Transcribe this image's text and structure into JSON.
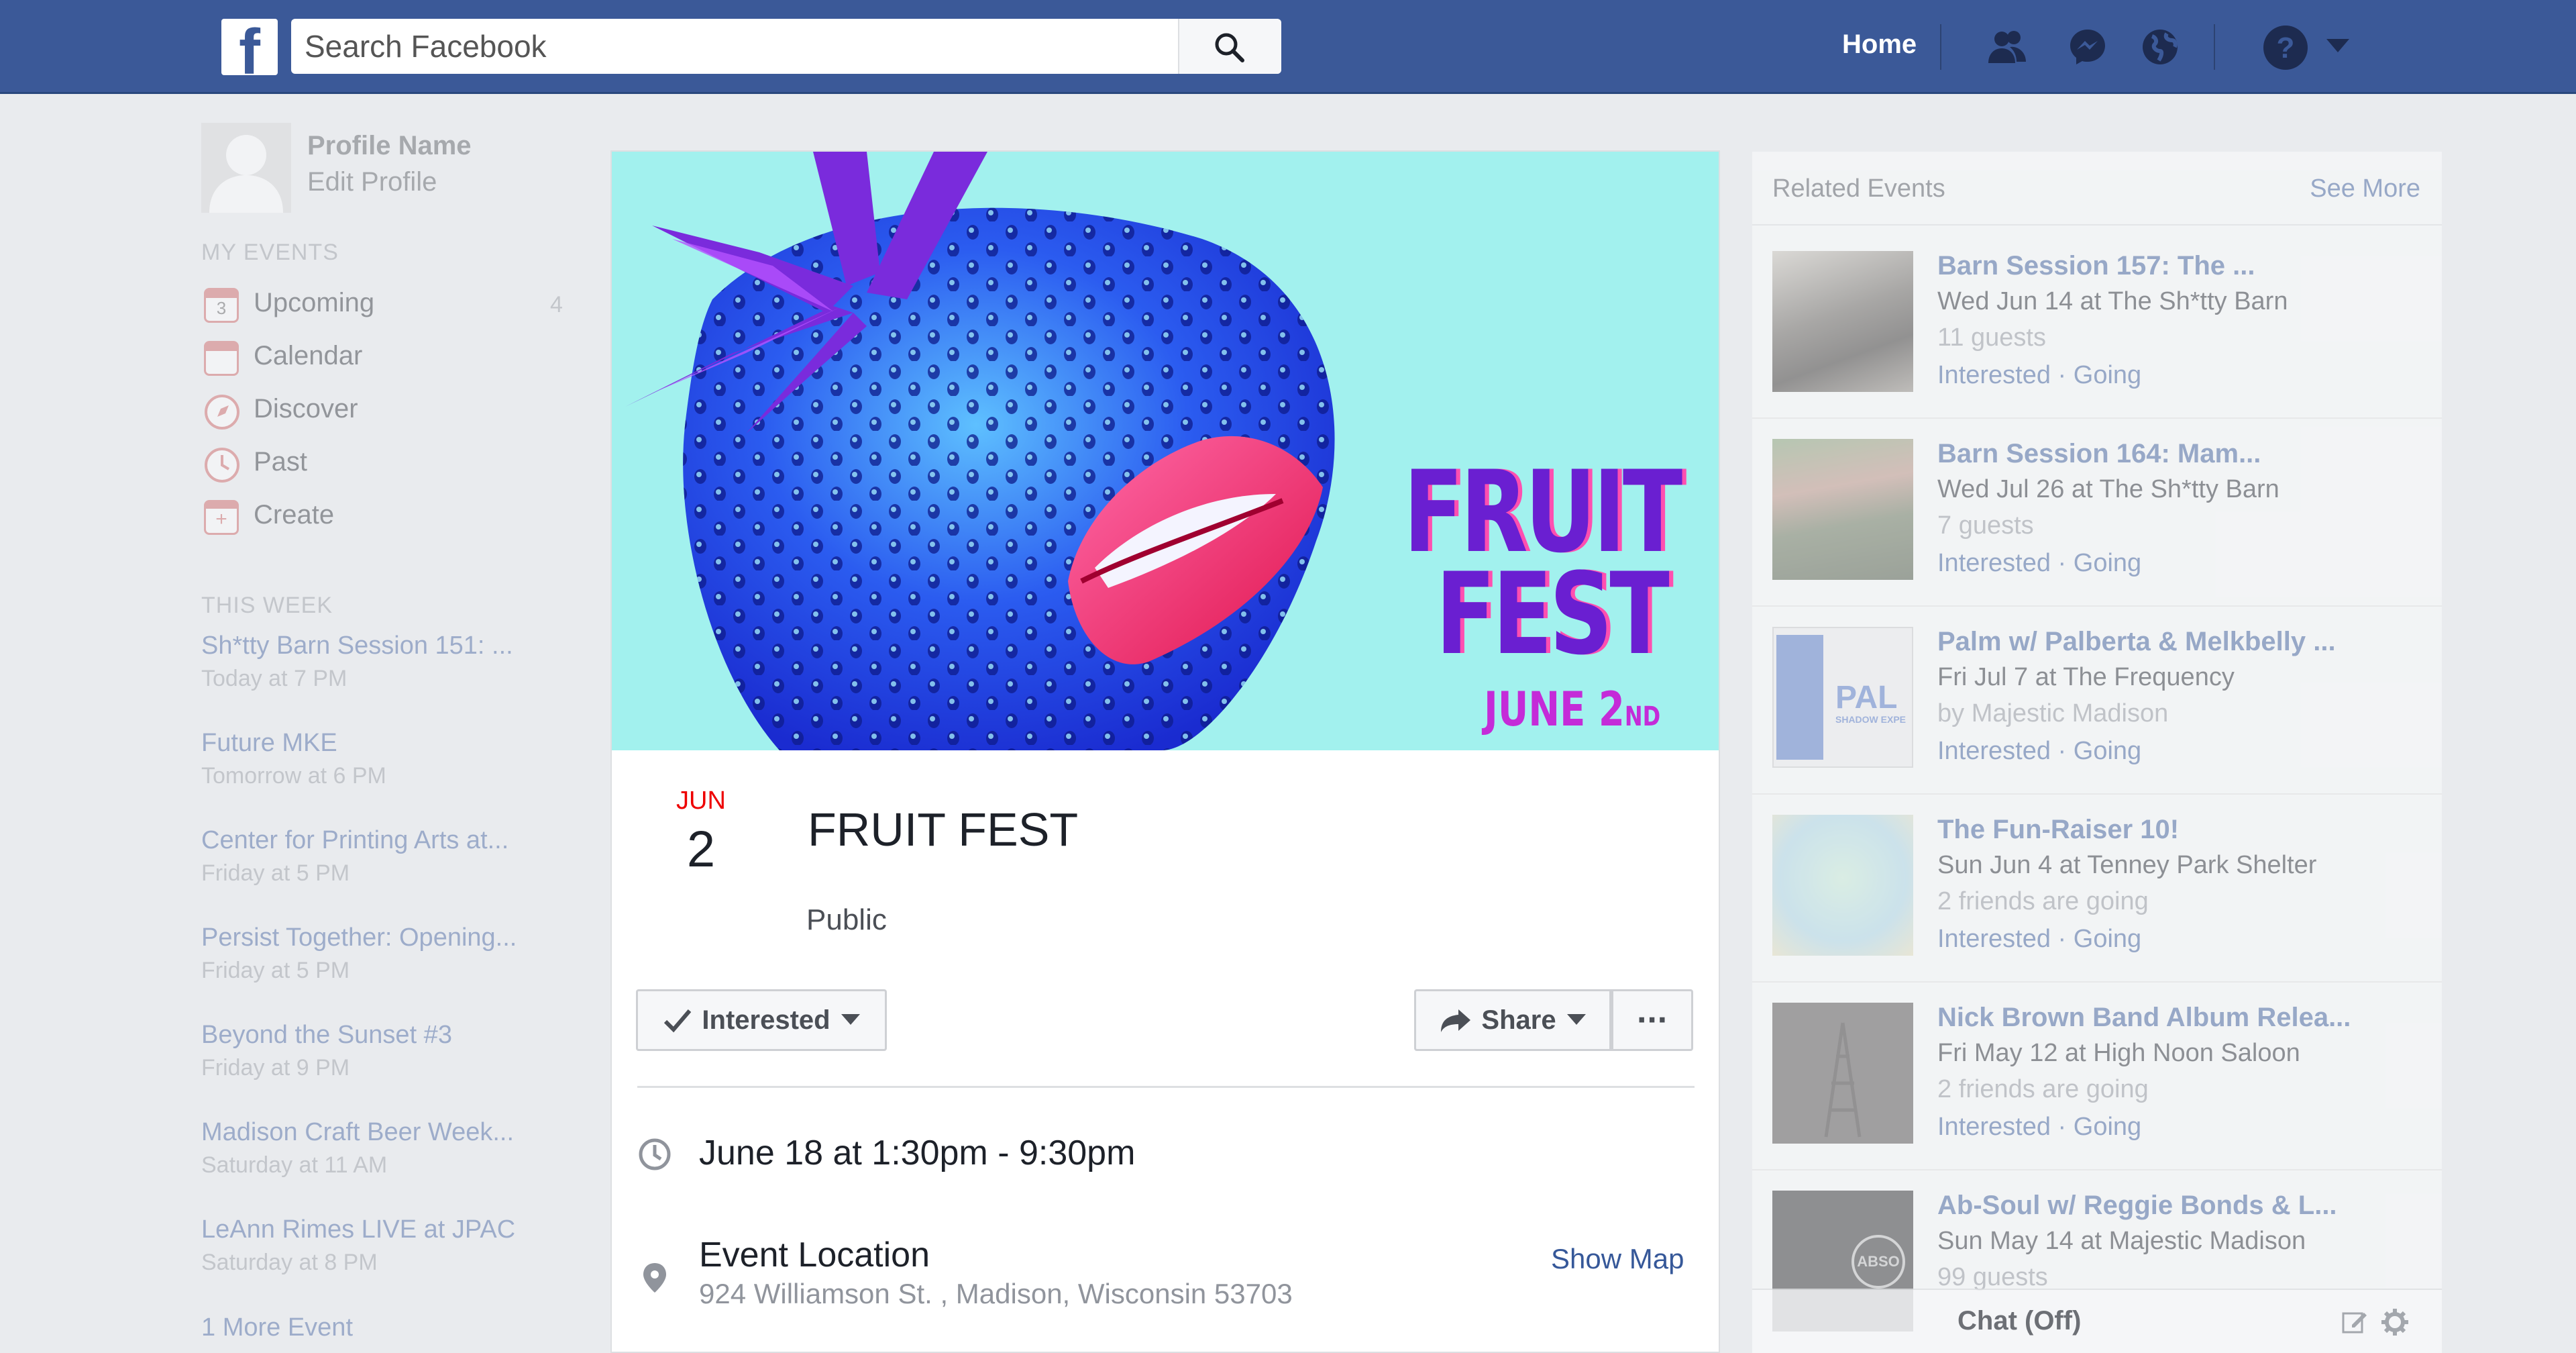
{
  "topbar": {
    "search_placeholder": "Search Facebook",
    "home_label": "Home",
    "logo_letter": "f",
    "icons": [
      "search-icon",
      "friends-icon",
      "messenger-icon",
      "globe-icon",
      "help-icon",
      "caret-down-icon"
    ]
  },
  "sidebar": {
    "profile_name": "Profile Name",
    "edit_profile": "Edit Profile",
    "my_events_heading": "MY EVENTS",
    "nav": [
      {
        "label": "Upcoming",
        "count": "4",
        "icon": "calendar-3-icon"
      },
      {
        "label": "Calendar",
        "icon": "calendar-icon"
      },
      {
        "label": "Discover",
        "icon": "compass-icon"
      },
      {
        "label": "Past",
        "icon": "clock-icon"
      },
      {
        "label": "Create",
        "icon": "plus-icon"
      }
    ],
    "upcoming_badge": "3",
    "this_week_heading": "THIS WEEK",
    "events": [
      {
        "title": "Sh*tty Barn Session 151: ...",
        "time": "Today at 7 PM"
      },
      {
        "title": "Future MKE",
        "time": "Tomorrow at 6 PM"
      },
      {
        "title": "Center for Printing Arts at...",
        "time": "Friday at 5 PM"
      },
      {
        "title": "Persist Together: Opening...",
        "time": "Friday at 5 PM"
      },
      {
        "title": "Beyond the Sunset #3",
        "time": "Friday at 9 PM"
      },
      {
        "title": "Madison Craft Beer Week...",
        "time": "Saturday at 11 AM"
      },
      {
        "title": "LeAnn Rimes LIVE at JPAC",
        "time": "Saturday at 8 PM"
      }
    ],
    "more_events": "1 More Event"
  },
  "event": {
    "cover_title_1": "FRUIT",
    "cover_title_2": "FEST",
    "cover_date": "JUNE 2",
    "cover_date_suffix": "ND",
    "month": "JUN",
    "day": "2",
    "title": "FRUIT FEST",
    "privacy": "Public",
    "interested_label": "Interested",
    "share_label": "Share",
    "more_label": "···",
    "time": "June 18 at 1:30pm - 9:30pm",
    "location_name": "Event Location",
    "address": "924 Williamson St. , Madison, Wisconsin 53703",
    "show_map": "Show Map"
  },
  "related": {
    "heading": "Related Events",
    "see_more": "See More",
    "items": [
      {
        "title": "Barn Session 157: The ...",
        "when": "Wed Jun 14 at The Sh*tty Barn",
        "extra": "11 guests",
        "actions": "Interested · Going"
      },
      {
        "title": "Barn Session 164: Mam...",
        "when": "Wed Jul 26 at The Sh*tty Barn",
        "extra": "7 guests",
        "actions": "Interested · Going"
      },
      {
        "title": "Palm w/ Palberta & Melkbelly ...",
        "when": "Fri Jul 7 at The Frequency",
        "extra": "by Majestic Madison",
        "actions": "Interested · Going"
      },
      {
        "title": "The Fun-Raiser 10!",
        "when": "Sun Jun 4 at Tenney Park Shelter",
        "extra": "2 friends are going",
        "actions": "Interested · Going"
      },
      {
        "title": "Nick Brown Band Album Relea...",
        "when": "Fri May 12 at High Noon Saloon",
        "extra": "2 friends are going",
        "actions": "Interested · Going"
      },
      {
        "title": "Ab-Soul w/ Reggie Bonds & L...",
        "when": "Sun May 14 at Majestic Madison",
        "extra": "99 guests",
        "actions": ""
      }
    ],
    "thumb3_text": "PAL",
    "thumb3_sub": "SHADOW EXPE",
    "thumb6_text": "ABSO"
  },
  "chat": {
    "label": "Chat (Off)"
  },
  "colors": {
    "brand": "#3b5998",
    "link": "#365899",
    "date_red": "#e00000",
    "cover_bg": "#a2f1ee",
    "cover_text": "#6a1fd1"
  }
}
